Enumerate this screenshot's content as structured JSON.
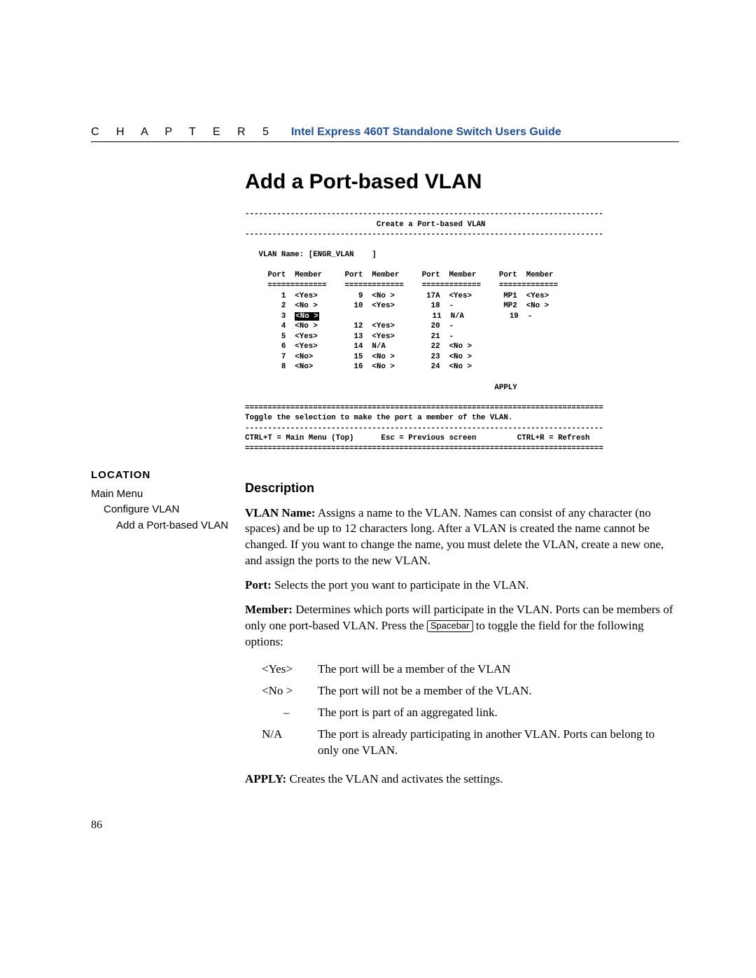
{
  "header": {
    "chapter_label": "C H A P T E R 5",
    "guide_title": "Intel Express 460T Standalone Switch Users Guide"
  },
  "title": "Add a Port-based VLAN",
  "terminal": {
    "border_top": "-------------------------------------------------------------------------------",
    "title_line": "                             Create a Port-based VLAN",
    "border_mid": "-------------------------------------------------------------------------------",
    "vlan_line": "   VLAN Name: [ENGR_VLAN    ]",
    "head_line": "     Port  Member     Port  Member     Port  Member     Port  Member",
    "sep_line": "     =============    =============    =============    =============",
    "rows": [
      "        1  <Yes>         9  <No >       17A  <Yes>       MP1  <Yes>",
      "        2  <No >        10  <Yes>        18  -           MP2  <No >",
      "                         11  N/A          19  -",
      "        4  <No >        12  <Yes>        20  -",
      "        5  <Yes>        13  <Yes>        21  -",
      "        6  <Yes>        14  N/A          22  <No >",
      "        7  <No>         15  <No >        23  <No >",
      "        8  <No>         16  <No >        24  <No >"
    ],
    "row3_prefix": "        3  ",
    "row3_highlight": "<No >",
    "apply_line": "                                                       APPLY",
    "divider": "===============================================================================",
    "hint_line": "Toggle the selection to make the port a member of the VLAN.",
    "dash_line": "-------------------------------------------------------------------------------",
    "footer_line": "CTRL+T = Main Menu (Top)      Esc = Previous screen         CTRL+R = Refresh"
  },
  "location": {
    "heading": "LOCATION",
    "l1": "Main Menu",
    "l2": "Configure VLAN",
    "l3": "Add a Port-based VLAN"
  },
  "description": {
    "heading": "Description",
    "vlan_name_label": "VLAN Name:",
    "vlan_name_text": " Assigns a name to the VLAN. Names can consist of any character (no spaces) and be up to 12 characters long. After a VLAN is created the name cannot be changed. If you want to change the name, you must delete the VLAN, create a new one, and assign the ports to the new VLAN.",
    "port_label": "Port:",
    "port_text": " Selects the port you want to participate in the VLAN.",
    "member_label": "Member:",
    "member_text_a": " Determines which ports will participate in the VLAN.  Ports can be members of only one port-based VLAN. Press the ",
    "spacebar": "Spacebar",
    "member_text_b": " to toggle the field for the following options:",
    "options": [
      {
        "k": "<Yes>",
        "v": "The port will be a member of the VLAN"
      },
      {
        "k": "<No >",
        "v": "The port will not be a member of the VLAN."
      },
      {
        "k": "   –",
        "v": "The port is part of an aggregated link."
      },
      {
        "k": "N/A",
        "v": "The port is already participating in another VLAN. Ports can belong to only one VLAN."
      }
    ],
    "apply_label": "APPLY:",
    "apply_text": " Creates the VLAN and activates the settings."
  },
  "page_number": "86"
}
